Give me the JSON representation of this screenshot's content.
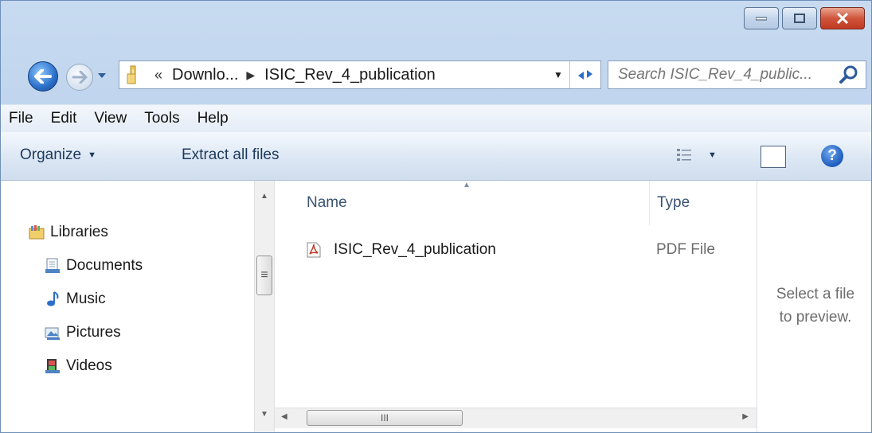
{
  "window": {
    "caption_buttons": [
      "minimize",
      "maximize",
      "close"
    ]
  },
  "nav": {
    "back_icon": "back-arrow-icon",
    "forward_icon": "forward-arrow-icon",
    "address": {
      "chevron": "«",
      "segments": [
        "Downlo...",
        "ISIC_Rev_4_publication"
      ]
    },
    "search": {
      "placeholder": "Search ISIC_Rev_4_public..."
    }
  },
  "menu": {
    "items": [
      "File",
      "Edit",
      "View",
      "Tools",
      "Help"
    ]
  },
  "toolbar": {
    "organize_label": "Organize",
    "extract_label": "Extract all files",
    "help_label": "?"
  },
  "sidebar": {
    "items": [
      {
        "label": "Libraries",
        "icon": "libraries-icon"
      },
      {
        "label": "Documents",
        "icon": "documents-icon"
      },
      {
        "label": "Music",
        "icon": "music-icon"
      },
      {
        "label": "Pictures",
        "icon": "pictures-icon"
      },
      {
        "label": "Videos",
        "icon": "videos-icon"
      }
    ]
  },
  "files": {
    "columns": [
      "Name",
      "Type"
    ],
    "rows": [
      {
        "name": "ISIC_Rev_4_publication",
        "type": "PDF File",
        "icon": "pdf-icon"
      }
    ]
  },
  "preview": {
    "line1": "Select a file",
    "line2": "to preview."
  },
  "colors": {
    "accent": "#1e395b",
    "frame": "#c7daf0",
    "close_button": "#c03a22"
  }
}
